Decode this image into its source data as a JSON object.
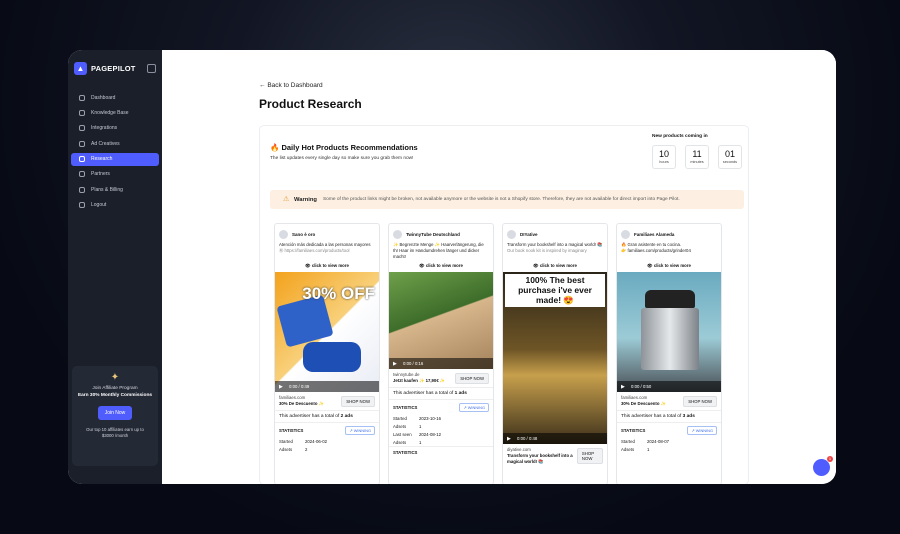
{
  "brand": {
    "name": "PAGEPILOT"
  },
  "sidebar": {
    "items": [
      {
        "label": "Dashboard",
        "icon": "dashboard-icon"
      },
      {
        "label": "Knowledge Base",
        "icon": "book-icon"
      },
      {
        "label": "Integrations",
        "icon": "plug-icon"
      },
      {
        "label": "Ad Creatives",
        "icon": "megaphone-icon"
      },
      {
        "label": "Research",
        "icon": "diamond-icon",
        "active": true
      },
      {
        "label": "Partners",
        "icon": "handshake-icon"
      },
      {
        "label": "Plans & Billing",
        "icon": "card-icon"
      },
      {
        "label": "Logout",
        "icon": "logout-icon"
      }
    ]
  },
  "affiliate": {
    "line1": "Join Affiliate Program",
    "line2": "Earn 30% Monthly Commissions",
    "button": "Join Now",
    "line3": "Our top 10 affiliates earn up to",
    "line4": "$3000 /month"
  },
  "header": {
    "back": "Back to Dashboard",
    "title": "Product Research"
  },
  "recs": {
    "title": "Daily Hot Products Recommendations",
    "subtitle": "The list updates every single day so make sure you grab them now!",
    "coming": "New products coming in",
    "countdown": [
      {
        "value": "10",
        "unit": "hours"
      },
      {
        "value": "11",
        "unit": "minutes"
      },
      {
        "value": "01",
        "unit": "seconds"
      }
    ]
  },
  "warning": {
    "label": "Warning",
    "text": "Some of the product links might be broken, not available anymore or the website is not a Shopify store. Therefore, they are not available for direct import into Page Pilot."
  },
  "ads": [
    {
      "page": "Sano è oro",
      "copy": "Atención más dedicada a las personas mayores",
      "copy2": "Ⓜ https://familiaes.com/products/tool",
      "cta": "click to view more",
      "time": "0:00 / 0:49",
      "domain": "familiaes.com",
      "offer": "30% De Descuento ✨",
      "shop": "SHOP NOW",
      "total_pre": "This advertiser has a total of ",
      "total": "2 ads",
      "started": "2024-06-02",
      "adsets": "2",
      "lastseen": "",
      "colors": [
        "#f3a21c",
        "#3b6fd1"
      ],
      "overlay": "30% OFF"
    },
    {
      "page": "TwinnyTube Deutschland",
      "copy": "✨ Begrenzte Menge ✨ Haarverlängerung, die Ihr Haar im Handumdrehen länger und dicker macht!",
      "copy2": "",
      "cta": "click to view more",
      "time": "0:00 / 0:16",
      "domain": "twinnytube.de",
      "offer": "Jetzt kaufen ✨ 17,90€ ✨",
      "shop": "SHOP NOW",
      "total_pre": "This advertiser has a total of ",
      "total": "1 ads",
      "started": "2023-10-16",
      "adsets": "1",
      "lastseen": "2024-08-12",
      "colors": [
        "#5d8a3c",
        "#c9a37a"
      ],
      "overlay": ""
    },
    {
      "page": "DIYative",
      "copy": "Transform your bookshelf into a magical world! 📚",
      "copy2": "Our book nook kit is inspired by imaginary",
      "cta": "click to view more",
      "time": "0:00 / 0:48",
      "domain": "diyative.com",
      "offer": "Transform your bookshelf into a magical world! 📚",
      "shop": "SHOP NOW",
      "total_pre": "",
      "total": "",
      "started": "",
      "adsets": "",
      "lastseen": "",
      "colors": [
        "#3a3220",
        "#8a6a30"
      ],
      "overlay": "100% The best purchase i've ever made! 😍"
    },
    {
      "page": "Familiaes Alameda",
      "copy": "🔥 Gran asistente en tu cocina.",
      "copy2": "👉 familiaes.com/products/grinder04",
      "cta": "click to view more",
      "time": "0:00 / 0:50",
      "domain": "familiaes.com",
      "offer": "30% De Descuento ✨",
      "shop": "SHOP NOW",
      "total_pre": "This advertiser has a total of ",
      "total": "3 ads",
      "started": "2024-08-07",
      "adsets": "1",
      "lastseen": "",
      "colors": [
        "#5a9ab0",
        "#c7d2d6"
      ],
      "overlay": ""
    }
  ],
  "stats_label": "STATISTICS",
  "winning": "WINNING",
  "labels": {
    "started": "Started",
    "adsets": "Adsets",
    "lastseen": "Last seen"
  },
  "accent": "#4f5dff"
}
